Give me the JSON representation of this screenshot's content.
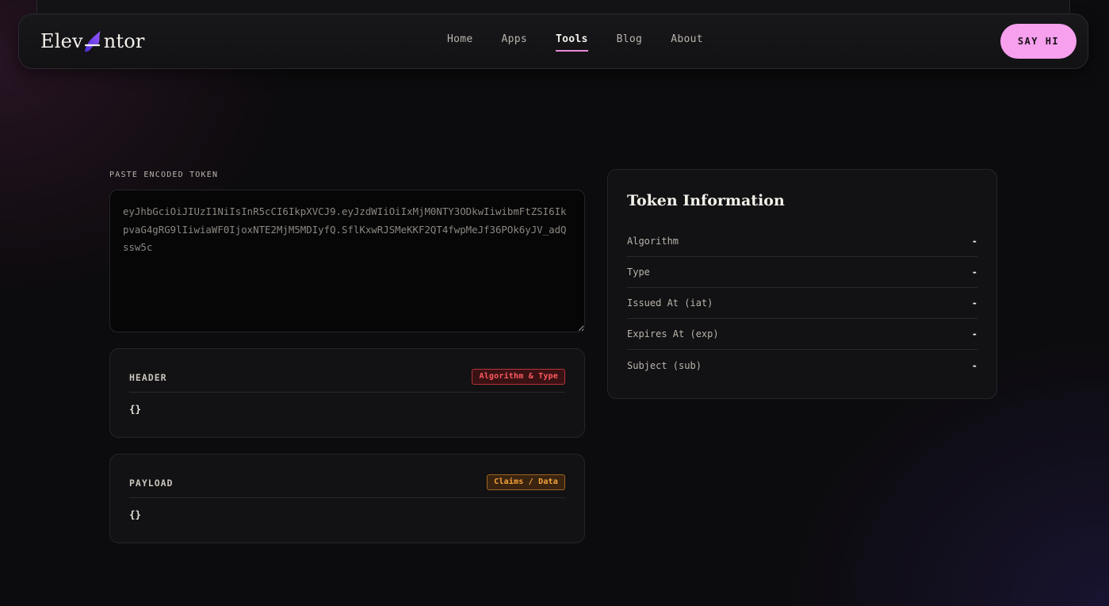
{
  "nav": {
    "logo_left": "Elev",
    "logo_right": "ntor",
    "logo_icon": "flame-icon",
    "items": [
      {
        "label": "Home",
        "active": false
      },
      {
        "label": "Apps",
        "active": false
      },
      {
        "label": "Tools",
        "active": true
      },
      {
        "label": "Blog",
        "active": false
      },
      {
        "label": "About",
        "active": false
      }
    ],
    "cta_label": "SAY HI"
  },
  "encoder": {
    "label": "PASTE ENCODED TOKEN",
    "token": "eyJhbGciOiJIUzI1NiIsInR5cCI6IkpXVCJ9.eyJzdWIiOiIxMjM0NTY3ODkwIiwibmFtZSI6IkpvaG4gRG9lIiwiaWF0IjoxNTE2MjM5MDIyfQ.SflKxwRJSMeKKF2QT4fwpMeJf36POk6yJV_adQssw5c"
  },
  "header_card": {
    "title": "HEADER",
    "badge": "Algorithm & Type",
    "json": "{}"
  },
  "payload_card": {
    "title": "PAYLOAD",
    "badge": "Claims / Data",
    "json": "{}"
  },
  "info": {
    "title": "Token Information",
    "rows": [
      {
        "key": "Algorithm",
        "value": "-"
      },
      {
        "key": "Type",
        "value": "-"
      },
      {
        "key": "Issued At (iat)",
        "value": "-"
      },
      {
        "key": "Expires At (exp)",
        "value": "-"
      },
      {
        "key": "Subject (sub)",
        "value": "-"
      }
    ]
  },
  "colors": {
    "accent_pink": "#f6a0ee",
    "badge_red": "#ff5a5f",
    "badge_orange": "#f7a43c",
    "logo_purple": "#6d3df0"
  }
}
